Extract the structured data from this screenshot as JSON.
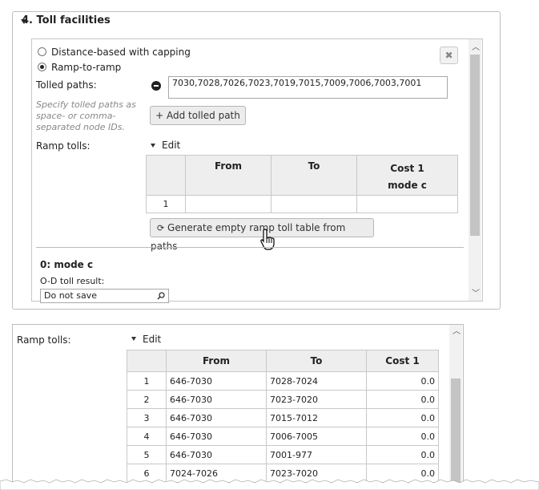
{
  "section": {
    "title": "4. Toll facilities"
  },
  "toll_method": {
    "options": [
      "Distance-based with capping",
      "Ramp-to-ramp"
    ],
    "selected": "Ramp-to-ramp"
  },
  "tolled_paths": {
    "label": "Tolled paths:",
    "value": "7030,7028,7026,7023,7019,7015,7009,7006,7003,7001",
    "help": [
      "Specify tolled paths as",
      "space- or comma-",
      "separated node IDs."
    ],
    "add_button": "+ Add tolled path"
  },
  "ramp_tolls": {
    "label": "Ramp tolls:",
    "edit_label": "Edit",
    "columns": [
      "From",
      "To",
      "Cost 1",
      "mode c"
    ],
    "rows": [
      [
        "1",
        "",
        "",
        ""
      ]
    ],
    "generate_button": "Generate empty ramp toll table from paths"
  },
  "mode_section": {
    "title": "0: mode c",
    "od_label": "O-D toll result:",
    "od_value": "Do not save"
  },
  "close_icon_glyph": "✖",
  "ramp_tolls_expanded": {
    "label": "Ramp tolls:",
    "edit_label": "Edit",
    "columns": [
      "From",
      "To",
      "Cost 1"
    ],
    "rows": [
      [
        "1",
        "646-7030",
        "7028-7024",
        "0.0"
      ],
      [
        "2",
        "646-7030",
        "7023-7020",
        "0.0"
      ],
      [
        "3",
        "646-7030",
        "7015-7012",
        "0.0"
      ],
      [
        "4",
        "646-7030",
        "7006-7005",
        "0.0"
      ],
      [
        "5",
        "646-7030",
        "7001-977",
        "0.0"
      ],
      [
        "6",
        "7024-7026",
        "7023-7020",
        "0.0"
      ]
    ]
  }
}
